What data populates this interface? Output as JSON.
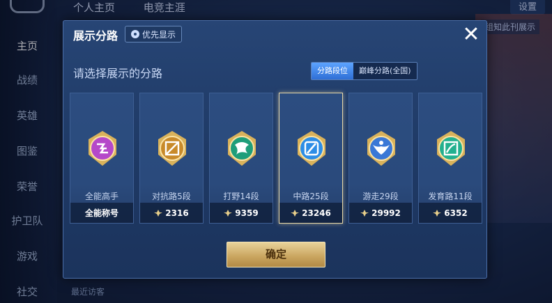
{
  "background": {
    "top_tabs": [
      "个人主页",
      "电竞主涯"
    ],
    "top_right_button": "设置",
    "right_tag": "组知此刊展示",
    "sidebar": [
      "主页",
      "战绩",
      "英雄",
      "图鉴",
      "荣誉",
      "护卫队",
      "游戏",
      "社交"
    ],
    "recent_visitors": "最近访客"
  },
  "modal": {
    "title": "展示分路",
    "priority_button": "优先显示",
    "close_symbol": "✕",
    "subtitle": "请选择展示的分路",
    "toggle": {
      "active": "分路段位",
      "inactive": "巅峰分路(全国)"
    },
    "cards": [
      {
        "name": "全能高手",
        "footer": "全能称号",
        "color": "#b548c9",
        "has_score": false
      },
      {
        "name": "对抗路5段",
        "footer": "2316",
        "color": "#c88a2a",
        "has_score": true
      },
      {
        "name": "打野14段",
        "footer": "9359",
        "color": "#1f9e7a",
        "has_score": true
      },
      {
        "name": "中路25段",
        "footer": "23246",
        "color": "#2c8de6",
        "has_score": true,
        "selected": true
      },
      {
        "name": "游走29段",
        "footer": "29992",
        "color": "#3a78d6",
        "has_score": true
      },
      {
        "name": "发育路11段",
        "footer": "6352",
        "color": "#23b08f",
        "has_score": true
      }
    ],
    "confirm": "确定"
  }
}
